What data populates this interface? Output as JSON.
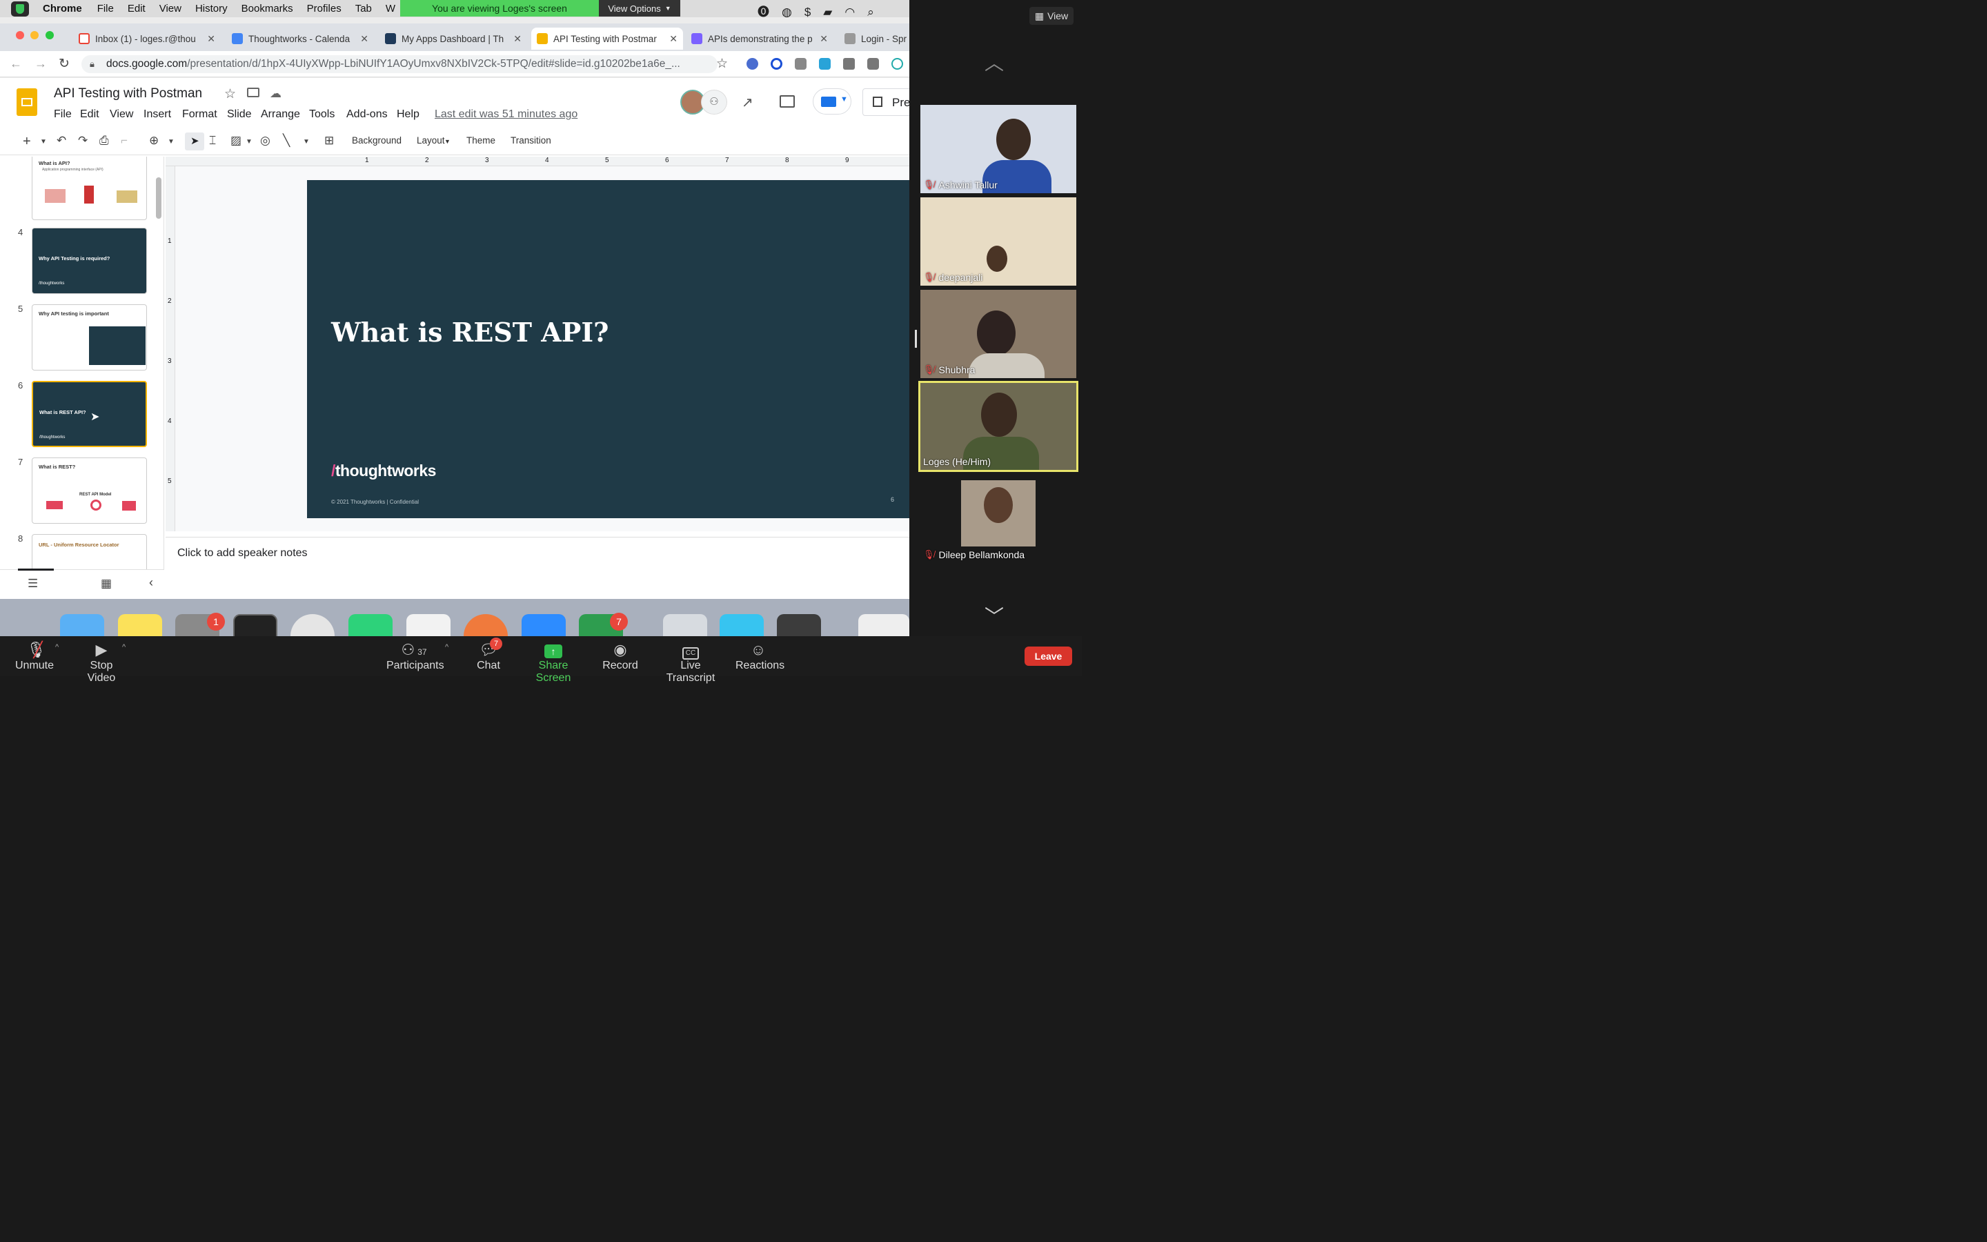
{
  "mac_menu": {
    "app": "Chrome",
    "items": [
      "File",
      "Edit",
      "View",
      "History",
      "Bookmarks",
      "Profiles",
      "Tab",
      "W"
    ]
  },
  "zoom_banner": {
    "text": "You are viewing Loges's screen",
    "view_options": "View Options"
  },
  "gallery_view_button": "View",
  "tabs": [
    {
      "title": "Inbox (1) - loges.r@thou",
      "color": "#ea4335"
    },
    {
      "title": "Thoughtworks - Calenda",
      "color": "#4285f4"
    },
    {
      "title": "My Apps Dashboard | Th",
      "color": "#1f3a5a"
    },
    {
      "title": "API Testing with Postmar",
      "color": "#f4b400"
    },
    {
      "title": "APIs demonstrating the p",
      "color": "#7b61ff"
    },
    {
      "title": "Login - Spr",
      "color": "#888888"
    }
  ],
  "url": {
    "domain": "docs.google.com",
    "path": "/presentation/d/1hpX-4UIyXWpp-LbiNUIfY1AOyUmxv8NXbIV2Ck-5TPQ/edit#slide=id.g10202be1a6e_..."
  },
  "doc": {
    "title": "API Testing with Postman",
    "menus": [
      "File",
      "Edit",
      "View",
      "Insert",
      "Format",
      "Slide",
      "Arrange",
      "Tools",
      "Add-ons",
      "Help"
    ],
    "last_edit": "Last edit was 51 minutes ago",
    "present_label": "Pres"
  },
  "toolbar": {
    "background": "Background",
    "layout": "Layout",
    "theme": "Theme",
    "transition": "Transition"
  },
  "ruler_numbers": [
    "1",
    "2",
    "3",
    "4",
    "5",
    "6",
    "7",
    "8",
    "9"
  ],
  "vruler_numbers": [
    "1",
    "2",
    "3",
    "4",
    "5"
  ],
  "slides": [
    {
      "num": "3",
      "title": "What is API?",
      "subtitle": "Application programming interface (API)"
    },
    {
      "num": "4",
      "title": "Why API Testing is required?",
      "logo": "/thoughtworks"
    },
    {
      "num": "5",
      "title": "Why API testing is important"
    },
    {
      "num": "6",
      "title": "What is REST API?",
      "logo": "/thoughtworks"
    },
    {
      "num": "7",
      "title": "What is REST?",
      "subtitle": "REST API Model"
    },
    {
      "num": "8",
      "title": "URL - Uniform Resource Locator"
    }
  ],
  "main_slide": {
    "title": "What is REST API?",
    "logo_slash": "/",
    "logo_text": "thoughtworks",
    "footer_left": "© 2021 Thoughtworks",
    "footer_sep": "|",
    "footer_conf": "Confidential",
    "page": "6"
  },
  "notes_placeholder": "Click to add speaker notes",
  "participants": [
    {
      "name": "Ashwini Tallur",
      "muted": true
    },
    {
      "name": "deepanjali",
      "muted": true
    },
    {
      "name": "Shubhra",
      "muted": true
    },
    {
      "name": "Loges  (He/Him)",
      "muted": false
    },
    {
      "name": "Dileep Bellamkonda",
      "muted": true
    }
  ],
  "dock_badges": {
    "settings": "1",
    "mail": "7"
  },
  "controls": {
    "unmute": "Unmute",
    "stop_video": "Stop Video",
    "participants": "Participants",
    "participants_count": "37",
    "chat": "Chat",
    "chat_badge": "7",
    "share": "Share Screen",
    "record": "Record",
    "transcript": "Live Transcript",
    "transcript_icon": "CC",
    "reactions": "Reactions",
    "leave": "Leave"
  },
  "colors": {
    "slide_bg": "#1f3a47",
    "zoom_green": "#4fd15c",
    "leave_red": "#d9342b",
    "active_speaker": "#e8e46a",
    "logo_slash": "#e64a8e"
  }
}
